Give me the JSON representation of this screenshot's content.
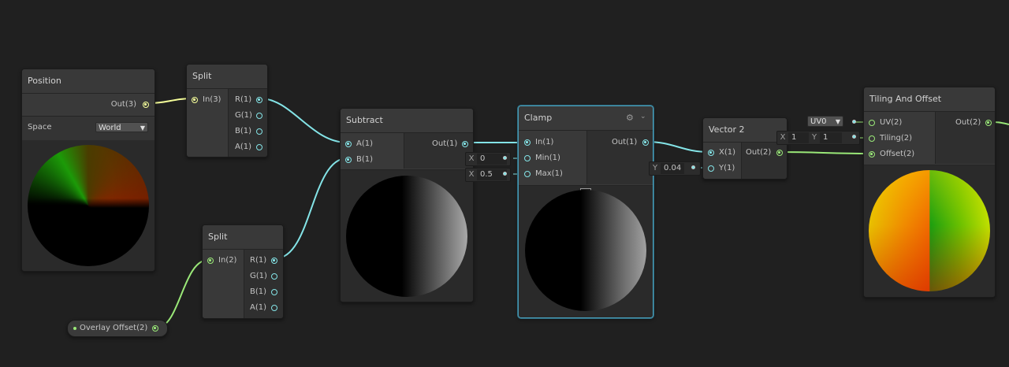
{
  "nodes": {
    "position": {
      "title": "Position",
      "out_label": "Out(3)",
      "space_label": "Space",
      "space_value": "World"
    },
    "split1": {
      "title": "Split",
      "in_label": "In(3)",
      "outs": [
        "R(1)",
        "G(1)",
        "B(1)",
        "A(1)"
      ]
    },
    "split2": {
      "title": "Split",
      "in_label": "In(2)",
      "outs": [
        "R(1)",
        "G(1)",
        "B(1)",
        "A(1)"
      ]
    },
    "overlay": {
      "label": "Overlay Offset(2)"
    },
    "subtract": {
      "title": "Subtract",
      "ins": [
        "A(1)",
        "B(1)"
      ],
      "out_label": "Out(1)"
    },
    "clamp": {
      "title": "Clamp",
      "ins": [
        "In(1)",
        "Min(1)",
        "Max(1)"
      ],
      "out_label": "Out(1)",
      "min_axis": "X",
      "min_value": "0",
      "max_axis": "X",
      "max_value": "0.5",
      "collapse_icon": "chevron-up-icon",
      "gear_icon": "gear-icon",
      "menu_icon": "chevron-down-icon"
    },
    "vector2": {
      "title": "Vector 2",
      "ins": [
        "X(1)",
        "Y(1)"
      ],
      "out_label": "Out(2)",
      "y_axis": "Y",
      "y_value": "0.04"
    },
    "tiling": {
      "title": "Tiling And Offset",
      "ins": [
        "UV(2)",
        "Tiling(2)",
        "Offset(2)"
      ],
      "out_label": "Out(2)",
      "uv_value": "UV0",
      "tiling_x_axis": "X",
      "tiling_x_value": "1",
      "tiling_y_axis": "Y",
      "tiling_y_value": "1"
    }
  },
  "colors": {
    "float_wire": "#84e4e7",
    "vector3_wire": "#f6ff9a",
    "vector2_wire": "#9ae878",
    "selection": "#4a9bb6"
  }
}
